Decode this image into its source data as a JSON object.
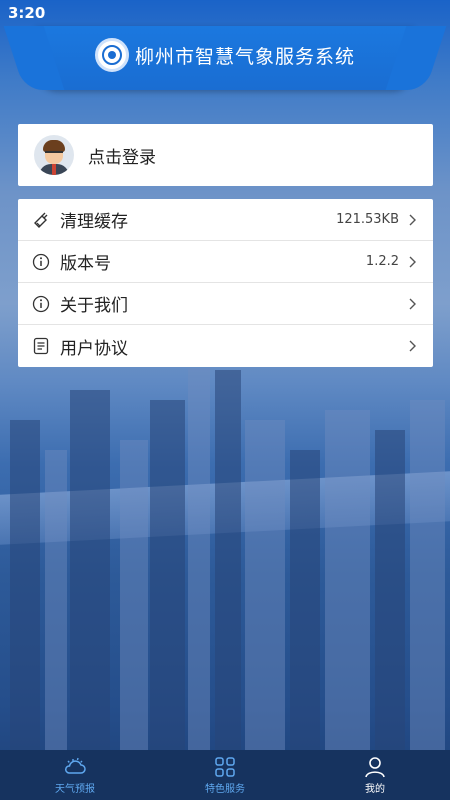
{
  "status_bar": {
    "time": "3:20"
  },
  "header": {
    "title": "柳州市智慧气象服务系统",
    "logo_icon": "weather-bureau-logo-icon"
  },
  "login": {
    "label": "点击登录",
    "avatar_icon": "user-avatar"
  },
  "settings": {
    "items": [
      {
        "label": "清理缓存",
        "value": "121.53KB",
        "icon": "broom-icon"
      },
      {
        "label": "版本号",
        "value": "1.2.2",
        "icon": "info-icon"
      },
      {
        "label": "关于我们",
        "value": "",
        "icon": "info-icon"
      },
      {
        "label": "用户协议",
        "value": "",
        "icon": "document-icon"
      }
    ]
  },
  "bottom_nav": {
    "items": [
      {
        "label": "天气预报",
        "icon": "cloud-sun-icon",
        "active": false
      },
      {
        "label": "特色服务",
        "icon": "grid-icon",
        "active": false
      },
      {
        "label": "我的",
        "icon": "person-icon",
        "active": true
      }
    ]
  },
  "colors": {
    "nav_bg": "#16335f",
    "header_blue": "#1a6dd2",
    "nav_inactive": "#5fa8ef"
  }
}
